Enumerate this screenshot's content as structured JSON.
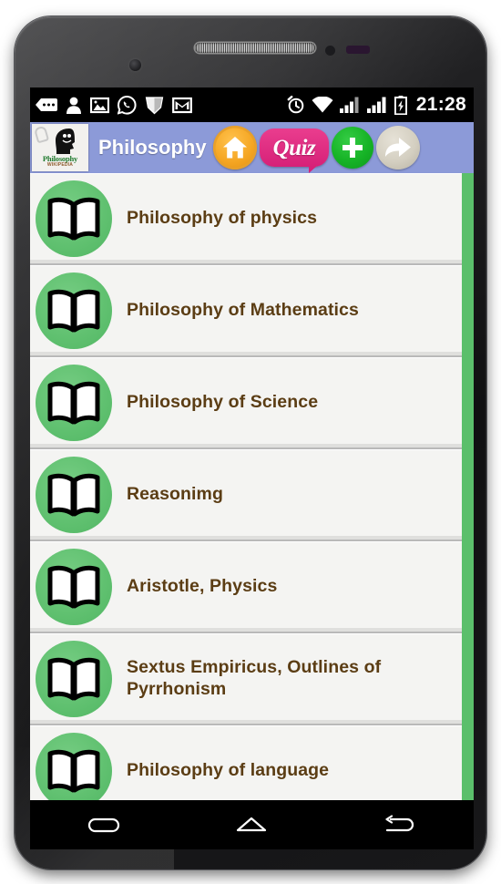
{
  "status_bar": {
    "icons": [
      {
        "name": "sms-icon",
        "label": "Messages"
      },
      {
        "name": "contact-icon",
        "label": "Contact"
      },
      {
        "name": "gallery-icon",
        "label": "Gallery"
      },
      {
        "name": "whatsapp-icon",
        "label": "WhatsApp"
      },
      {
        "name": "shield-icon",
        "label": "Security"
      },
      {
        "name": "gmail-icon",
        "label": "Gmail"
      }
    ],
    "right_icons": [
      {
        "name": "alarm-icon",
        "label": "Alarm"
      },
      {
        "name": "wifi-icon",
        "label": "Wi-Fi"
      },
      {
        "name": "signal-sim1-icon",
        "label": "Signal SIM 1"
      },
      {
        "name": "signal-sim2-icon",
        "label": "Signal SIM 2"
      },
      {
        "name": "battery-charging-icon",
        "label": "Battery charging"
      }
    ],
    "clock": "21:28"
  },
  "toolbar": {
    "app_logo_word": "Philosophy",
    "app_logo_sub": "WIKIPEDIA",
    "title": "Philosophy",
    "home_label": "Home",
    "quiz_label": "Quiz",
    "add_label": "Add",
    "share_label": "Share"
  },
  "list": {
    "items": [
      {
        "label": "Philosophy of physics",
        "icon": "book-icon"
      },
      {
        "label": "Philosophy of Mathematics",
        "icon": "book-icon"
      },
      {
        "label": "Philosophy of Science",
        "icon": "book-icon"
      },
      {
        "label": "Reasonimg",
        "icon": "book-icon"
      },
      {
        "label": "Aristotle, Physics",
        "icon": "book-icon"
      },
      {
        "label": "Sextus Empiricus, Outlines of Pyrrhonism",
        "icon": "book-icon"
      },
      {
        "label": "Philosophy of language",
        "icon": "book-icon"
      }
    ]
  },
  "nav_bar": {
    "recents_label": "Recent apps",
    "home_label": "Home",
    "back_label": "Back"
  },
  "colors": {
    "toolbar_blue": "#8c9ad8",
    "row_icon_green": "#5fc06f",
    "scrollbar_green": "#5bbf6b",
    "label_brown": "#5b3d14",
    "quiz_pink": "#d62178",
    "home_orange": "#f5a623",
    "add_green": "#16b326",
    "share_beige": "#d4cfc1",
    "row_background": "#f4f4f2"
  }
}
